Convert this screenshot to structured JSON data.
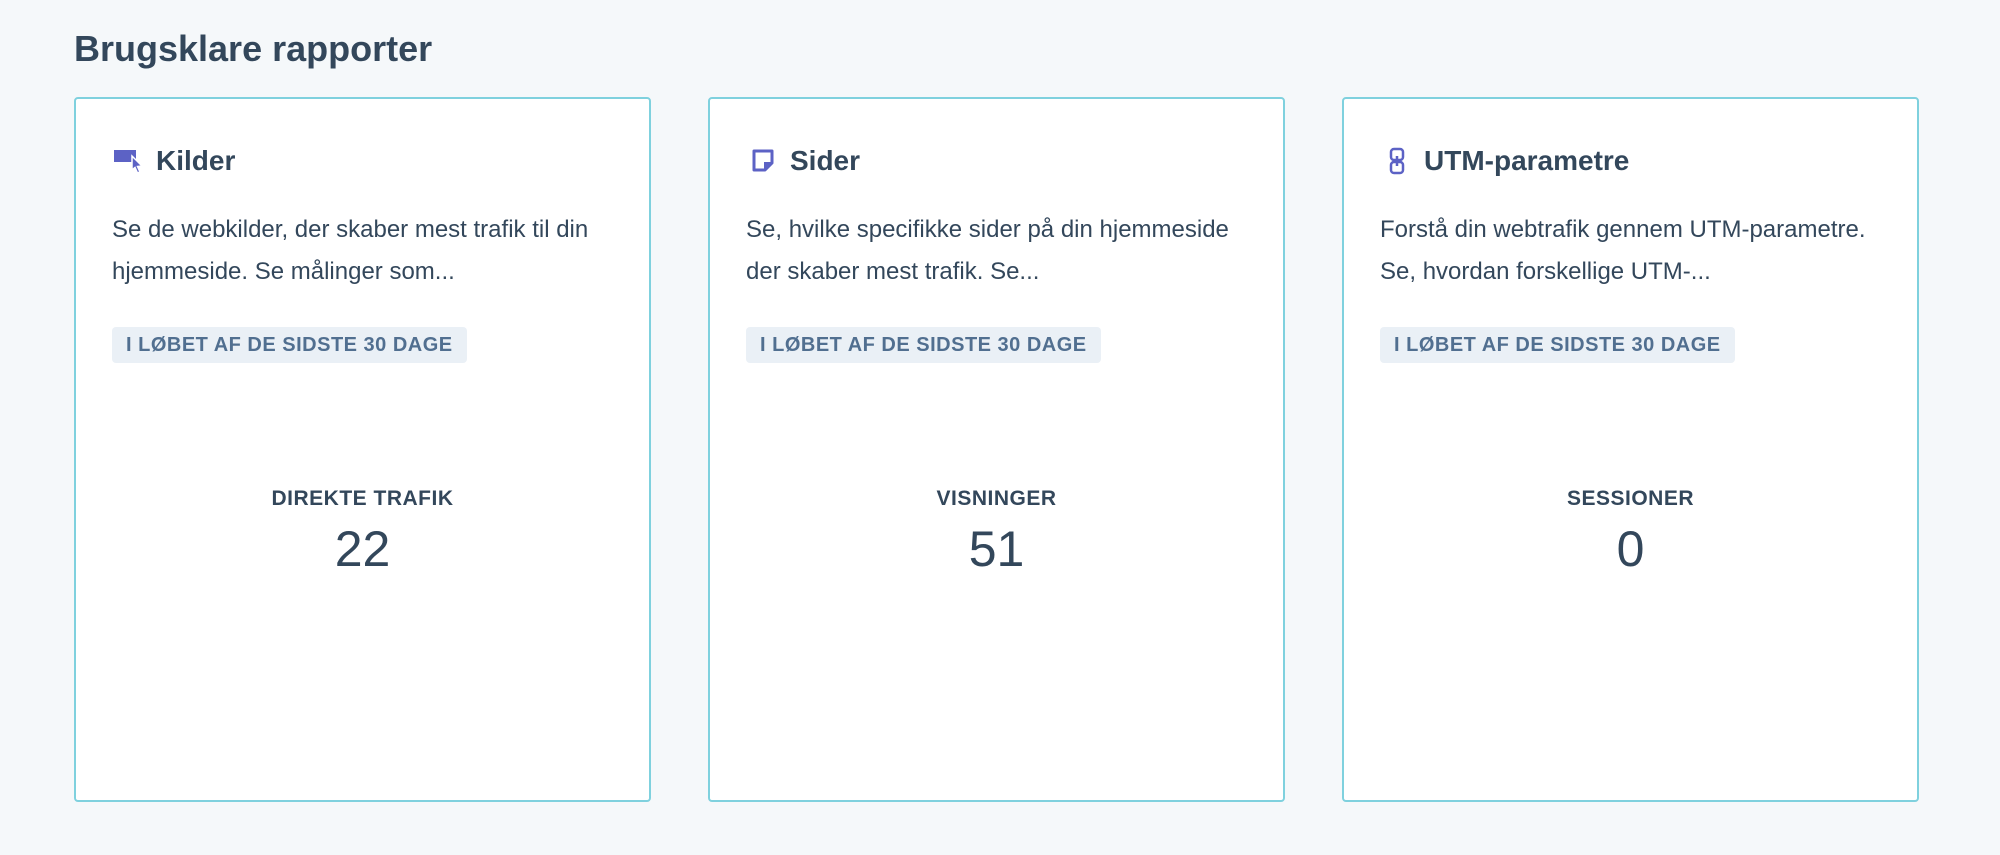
{
  "section": {
    "title": "Brugsklare rapporter"
  },
  "cards": [
    {
      "icon": "traffic-source-icon",
      "title": "Kilder",
      "description": "Se de webkilder, der skaber mest trafik til din hjemmeside. Se målinger som...",
      "badge": "I LØBET AF DE SIDSTE 30 DAGE",
      "metric_label": "DIREKTE TRAFIK",
      "metric_value": "22"
    },
    {
      "icon": "page-icon",
      "title": "Sider",
      "description": "Se, hvilke specifikke sider på din hjemmeside der skaber mest trafik. Se...",
      "badge": "I LØBET AF DE SIDSTE 30 DAGE",
      "metric_label": "VISNINGER",
      "metric_value": "51"
    },
    {
      "icon": "link-icon",
      "title": "UTM-parametre",
      "description": "Forstå din webtrafik gennem UTM-parametre. Se, hvordan forskellige UTM-...",
      "badge": "I LØBET AF DE SIDSTE 30 DAGE",
      "metric_label": "SESSIONER",
      "metric_value": "0"
    }
  ],
  "colors": {
    "card_border": "#7fd1de",
    "icon": "#5c62c5",
    "text": "#33475b",
    "badge_bg": "#eaf0f6",
    "badge_text": "#516f90"
  }
}
